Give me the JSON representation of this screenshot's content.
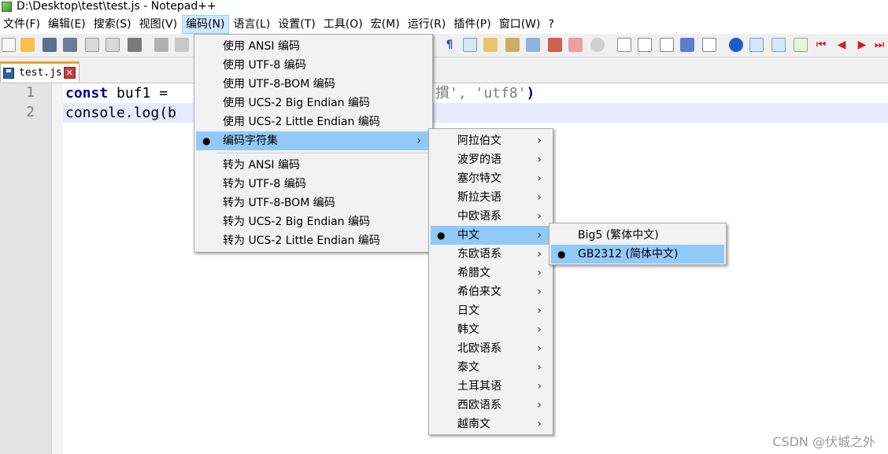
{
  "window": {
    "title": "D:\\Desktop\\test\\test.js - Notepad++"
  },
  "menubar": [
    "文件(F)",
    "编辑(E)",
    "搜索(S)",
    "视图(V)",
    "编码(N)",
    "语言(L)",
    "设置(T)",
    "工具(O)",
    "宏(M)",
    "运行(R)",
    "插件(P)",
    "窗口(W)",
    "?"
  ],
  "tab": {
    "label": "test.js",
    "close": "✕"
  },
  "editor": {
    "line_numbers": [
      "1",
      "2"
    ],
    "line1": {
      "kw": "const",
      "rest": " buf1 = ",
      "str": "摜', 'utf8'",
      "close": ")"
    },
    "line2": {
      "text": "console.log(",
      "tail": "b"
    }
  },
  "encoding_menu": {
    "use_ansi": "使用 ANSI 编码",
    "use_utf8": "使用 UTF-8 编码",
    "use_utf8_bom": "使用 UTF-8-BOM 编码",
    "use_ucs2_be": "使用 UCS-2 Big Endian 编码",
    "use_ucs2_le": "使用 UCS-2 Little Endian 编码",
    "charset": "编码字符集",
    "to_ansi": "转为 ANSI 编码",
    "to_utf8": "转为 UTF-8 编码",
    "to_utf8_bom": "转为 UTF-8-BOM 编码",
    "to_ucs2_be": "转为 UCS-2 Big Endian 编码",
    "to_ucs2_le": "转为 UCS-2 Little Endian 编码"
  },
  "charset_menu": [
    "阿拉伯文",
    "波罗的语",
    "塞尔特文",
    "斯拉夫语",
    "中欧语系",
    "中文",
    "东欧语系",
    "希腊文",
    "希伯来文",
    "日文",
    "韩文",
    "北欧语系",
    "泰文",
    "土耳其语",
    "西欧语系",
    "越南文"
  ],
  "chinese_menu": [
    "Big5 (繁体中文)",
    "GB2312 (简体中文)"
  ],
  "glyphs": {
    "bullet": "●",
    "arrow": "›"
  },
  "watermark": "CSDN @伏城之外"
}
